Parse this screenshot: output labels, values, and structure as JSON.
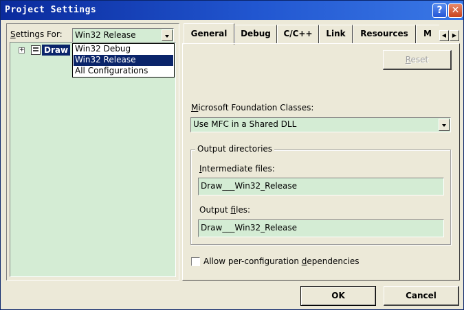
{
  "window": {
    "title": "Project Settings",
    "help_glyph": "?",
    "close_glyph": "✕"
  },
  "left": {
    "settings_for_label": "Settings For:",
    "settings_for_value": "Win32 Release",
    "dropdown_options": [
      "Win32 Debug",
      "Win32 Release",
      "All Configurations"
    ],
    "selected_option_index": 1,
    "tree_item": "Draw"
  },
  "tabs": {
    "items": [
      "General",
      "Debug",
      "C/C++",
      "Link",
      "Resources",
      "M"
    ],
    "active_index": 0,
    "scroll_left_glyph": "◀",
    "scroll_right_glyph": "▶"
  },
  "general": {
    "reset_label": "Reset",
    "mfc_label": "Microsoft Foundation Classes:",
    "mfc_value": "Use MFC in a Shared DLL",
    "output_group_label": "Output directories",
    "intermediate_label": "Intermediate files:",
    "intermediate_value": "Draw___Win32_Release",
    "output_label": "Output files:",
    "output_value": "Draw___Win32_Release",
    "allow_label": "Allow per-configuration dependencies",
    "allow_checked": false
  },
  "footer": {
    "ok_label": "OK",
    "cancel_label": "Cancel"
  },
  "colors": {
    "title_start": "#0a2a9c",
    "title_end": "#3a78e6",
    "selection": "#0a246a",
    "field_bg": "#d4ecd4",
    "dialog_bg": "#ece9d8"
  }
}
